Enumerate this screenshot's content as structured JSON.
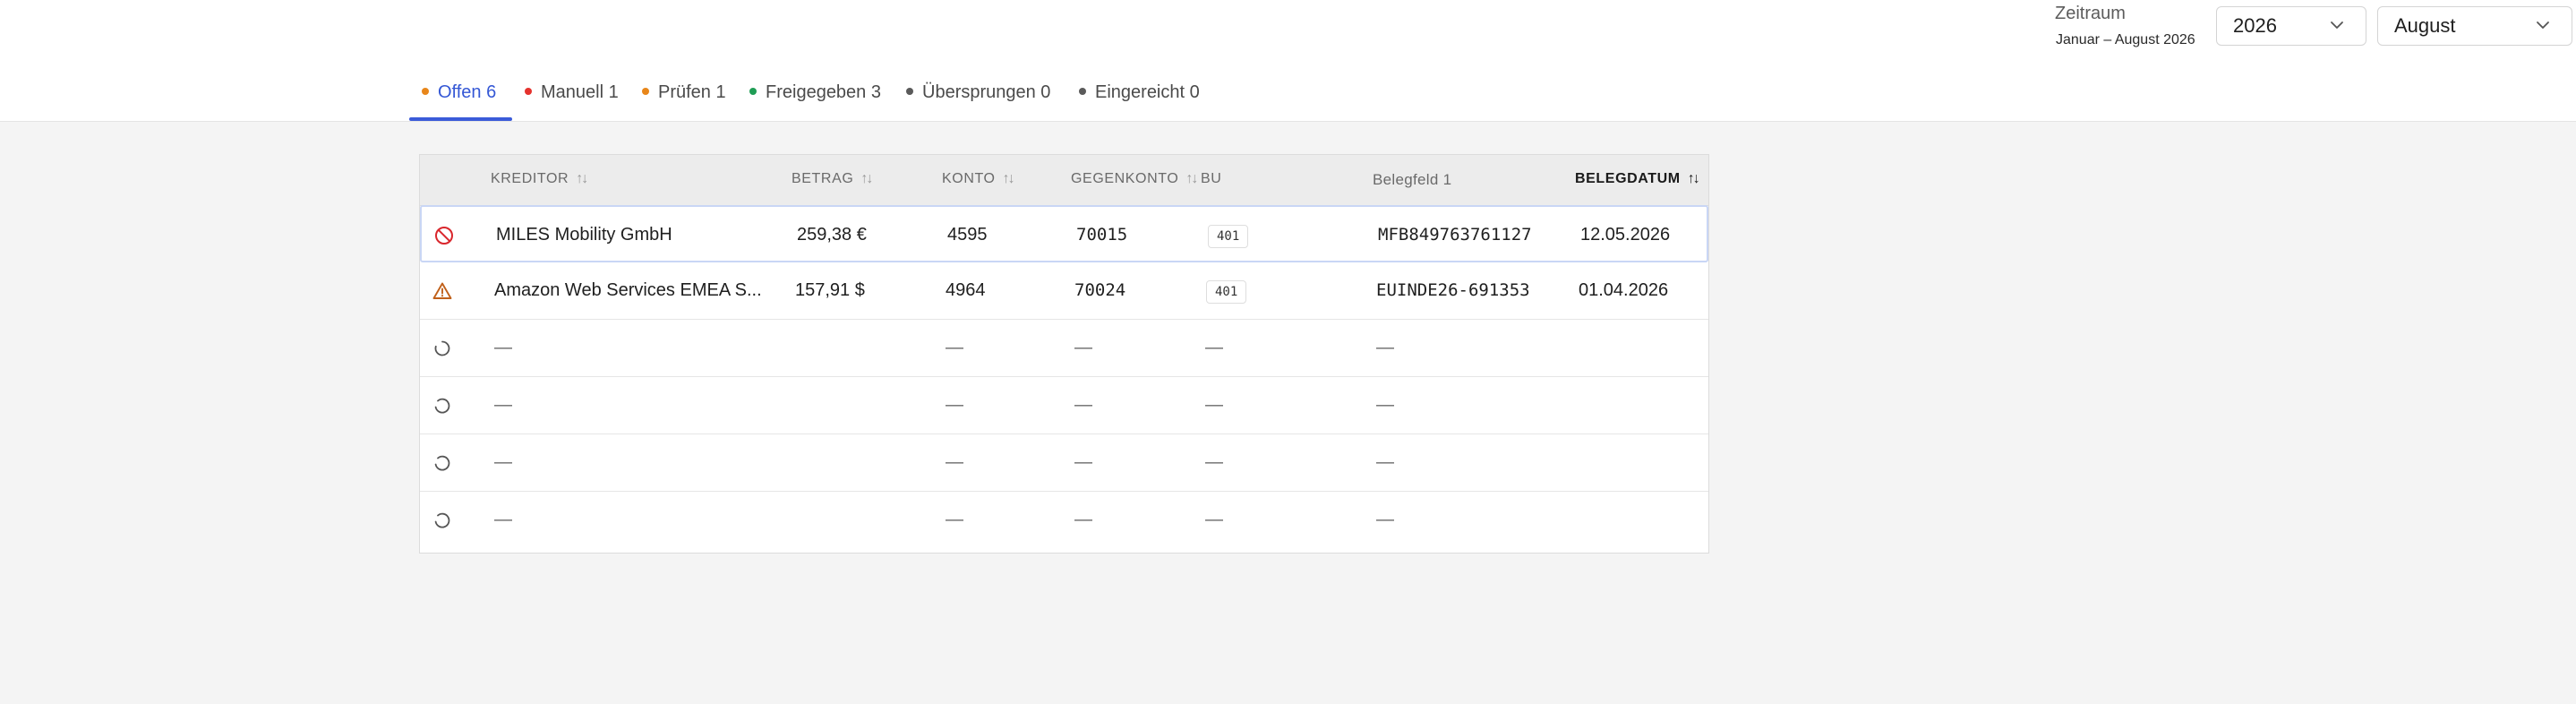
{
  "header": {
    "period_label": "Zeitraum",
    "period_range": "Januar – August 2026",
    "year_value": "2026",
    "month_value": "August"
  },
  "tabs": [
    {
      "label": "Offen 6",
      "dot_color": "#e8861a",
      "active": true
    },
    {
      "label": "Manuell 1",
      "dot_color": "#e5322d",
      "active": false
    },
    {
      "label": "Prüfen 1",
      "dot_color": "#e8861a",
      "active": false
    },
    {
      "label": "Freigegeben 3",
      "dot_color": "#1f9d55",
      "active": false
    },
    {
      "label": "Übersprungen 0",
      "dot_color": "#5a5a5a",
      "active": false
    },
    {
      "label": "Eingereicht 0",
      "dot_color": "#5a5a5a",
      "active": false
    }
  ],
  "table": {
    "columns": {
      "kreditor": "KREDITOR",
      "betrag": "BETRAG",
      "konto": "KONTO",
      "gegenkonto": "GEGENKONTO",
      "bu": "BU",
      "belegfeld": "Belegfeld 1",
      "belegdatum": "BELEGDATUM"
    },
    "rows": [
      {
        "status_icon": "blocked-icon",
        "kreditor": "MILES Mobility GmbH",
        "betrag": "259,38 €",
        "konto": "4595",
        "gegenkonto": "70015",
        "bu": "401",
        "belegfeld": "MFB849763761127",
        "belegdatum": "12.05.2026"
      },
      {
        "status_icon": "warning-icon",
        "kreditor": "Amazon Web Services EMEA S...",
        "betrag": "157,91 $",
        "konto": "4964",
        "gegenkonto": "70024",
        "bu": "401",
        "belegfeld": "EUINDE26-691353",
        "belegdatum": "01.04.2026"
      },
      {
        "status_icon": "loading-icon",
        "kreditor": "—",
        "konto": "—",
        "gegenkonto": "—",
        "bu": "—",
        "belegfeld": "—"
      },
      {
        "status_icon": "loading-icon",
        "kreditor": "—",
        "konto": "—",
        "gegenkonto": "—",
        "bu": "—",
        "belegfeld": "—"
      },
      {
        "status_icon": "loading-icon",
        "kreditor": "—",
        "konto": "—",
        "gegenkonto": "—",
        "bu": "—",
        "belegfeld": "—"
      },
      {
        "status_icon": "loading-icon",
        "kreditor": "—",
        "konto": "—",
        "gegenkonto": "—",
        "bu": "—",
        "belegfeld": "—"
      }
    ]
  },
  "colors": {
    "accent": "#3457d5",
    "danger": "#d9262c",
    "warning": "#c0601a"
  }
}
